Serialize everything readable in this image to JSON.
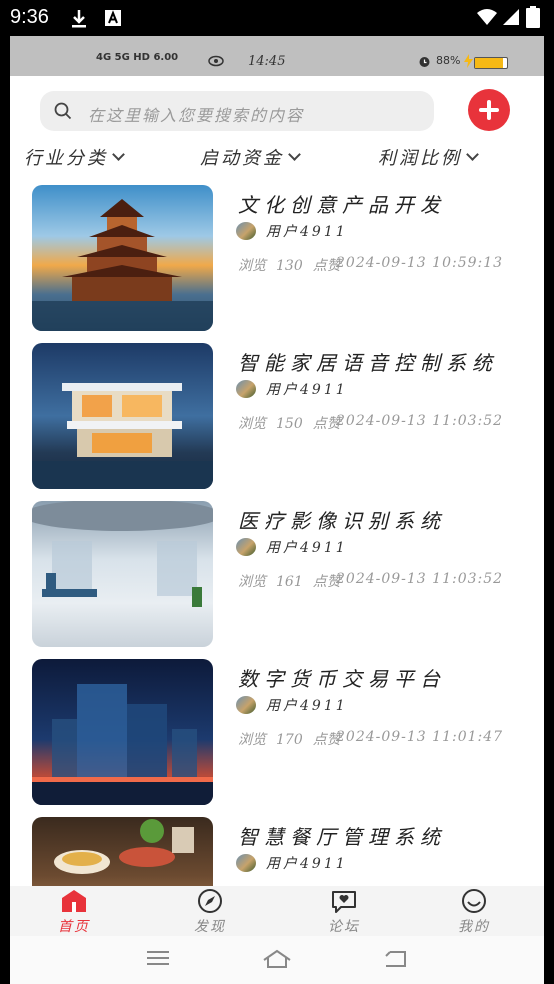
{
  "status_bar": {
    "time": "9:36"
  },
  "inner_status": {
    "network": "4G  5G  HD  6.00",
    "time": "14:45",
    "battery_text": "88%",
    "battery_level": 0.88
  },
  "search": {
    "placeholder": "在这里输入您要搜索的内容"
  },
  "filters": [
    {
      "label": "行业分类"
    },
    {
      "label": "启动资金"
    },
    {
      "label": "利润比例"
    }
  ],
  "items": [
    {
      "title": "文化创意产品开发",
      "author": "用户4911",
      "views_label": "浏览",
      "views": "130",
      "likes_label": "点赞",
      "date": "2024-09-13 10:59:13"
    },
    {
      "title": "智能家居语音控制系统",
      "author": "用户4911",
      "views_label": "浏览",
      "views": "150",
      "likes_label": "点赞",
      "date": "2024-09-13 11:03:52"
    },
    {
      "title": "医疗影像识别系统",
      "author": "用户4911",
      "views_label": "浏览",
      "views": "161",
      "likes_label": "点赞",
      "date": "2024-09-13 11:03:52"
    },
    {
      "title": "数字货币交易平台",
      "author": "用户4911",
      "views_label": "浏览",
      "views": "170",
      "likes_label": "点赞",
      "date": "2024-09-13 11:01:47"
    },
    {
      "title": "智慧餐厅管理系统",
      "author": "用户4911"
    }
  ],
  "tabs": [
    {
      "label": "首页",
      "icon": "home-icon",
      "active": true
    },
    {
      "label": "发现",
      "icon": "compass-icon",
      "active": false
    },
    {
      "label": "论坛",
      "icon": "forum-icon",
      "active": false
    },
    {
      "label": "我的",
      "icon": "profile-icon",
      "active": false
    }
  ],
  "colors": {
    "accent": "#e8333b",
    "battery": "#f6b916"
  }
}
